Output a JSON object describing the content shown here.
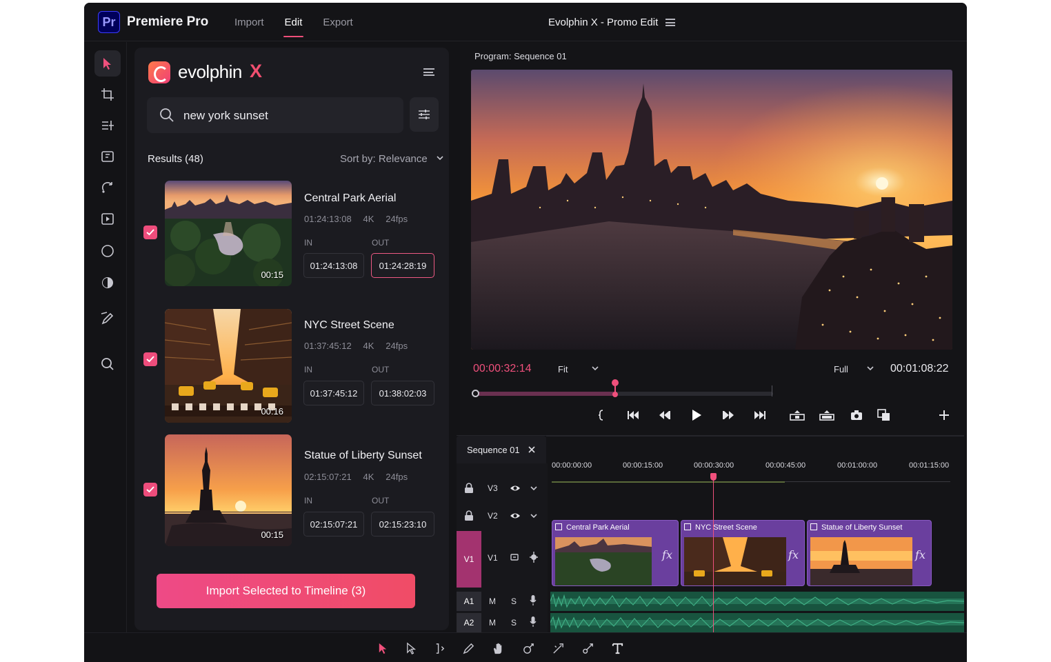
{
  "app": {
    "name": "Premiere Pro",
    "logo_text": "Pr",
    "project_title": "Evolphin X - Promo Edit",
    "nav_tabs": [
      "Import",
      "Edit",
      "Export"
    ],
    "active_tab": "Edit"
  },
  "tools_rail": [
    "selection-tool",
    "crop-tool",
    "track-select-tool",
    "ripple-edit-tool",
    "rolling-edit-tool",
    "rate-stretch-tool",
    "razor-tool",
    "slip-tool",
    "pen-tool",
    "zoom-tool",
    "lock-tool"
  ],
  "evolphin": {
    "brand": "evolphin",
    "brand_suffix": "X",
    "search_value": "new york sunset",
    "results_label": "Results (48)",
    "sort_label": "Sort by: Relevance",
    "in_label": "IN",
    "out_label": "OUT",
    "items": [
      {
        "title": "Central Park Aerial",
        "timecode": "01:24:13:08",
        "resolution": "4K",
        "fps": "24fps",
        "duration": "00:15",
        "in": "01:24:13:08",
        "out": "01:24:28:19",
        "checked": true
      },
      {
        "title": "NYC Street Scene",
        "timecode": "01:37:45:12",
        "resolution": "4K",
        "fps": "24fps",
        "duration": "00:16",
        "in": "01:37:45:12",
        "out": "01:38:02:03",
        "checked": true
      },
      {
        "title": "Statue of Liberty Sunset",
        "timecode": "02:15:07:21",
        "resolution": "4K",
        "fps": "24fps",
        "duration": "00:15",
        "in": "02:15:07:21",
        "out": "02:15:23:10",
        "checked": true
      }
    ],
    "import_button": "Import Selected to Timeline (3)"
  },
  "program_monitor": {
    "title": "Program: Sequence 01",
    "current_timecode": "00:00:32:14",
    "zoom": "Fit",
    "quality": "Full",
    "duration_timecode": "00:01:08:22",
    "playhead_fraction": 0.47
  },
  "timeline": {
    "sequence_tab": "Sequence 01",
    "ruler": [
      "00:00:00:00",
      "00:00:15:00",
      "00:00:30:00",
      "00:00:45:00",
      "00:01:00:00",
      "00:01:15:00"
    ],
    "tracks": {
      "video": [
        {
          "name": "V3"
        },
        {
          "name": "V2"
        },
        {
          "name": "V1",
          "source": "V1"
        }
      ],
      "audio": [
        {
          "name": "A1",
          "m": "M",
          "s": "S"
        },
        {
          "name": "A2",
          "m": "M",
          "s": "S"
        }
      ]
    },
    "clips": [
      {
        "title": "Central Park Aerial",
        "fx": "fx"
      },
      {
        "title": "NYC Street Scene",
        "fx": "fx"
      },
      {
        "title": "Statue of Liberty Sunset",
        "fx": "fx"
      }
    ]
  },
  "colors": {
    "accent": "#EF4F7A",
    "clip": "#6A3F9E",
    "audio": "#18543F",
    "background": "#131316"
  }
}
